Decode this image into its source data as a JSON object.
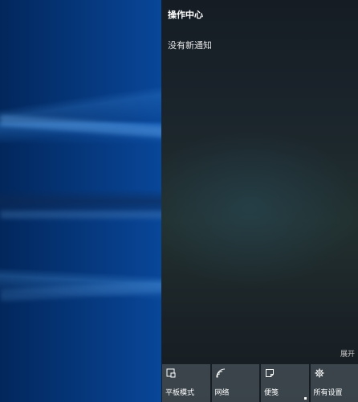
{
  "action_center": {
    "title": "操作中心",
    "status": "没有新通知",
    "expand_label": "展开",
    "quick_actions": [
      {
        "label": "平板模式",
        "icon": "tablet-mode-icon"
      },
      {
        "label": "网络",
        "icon": "network-icon"
      },
      {
        "label": "便笺",
        "icon": "note-icon"
      },
      {
        "label": "所有设置",
        "icon": "gear-icon"
      }
    ]
  },
  "colors": {
    "panel_background": "#1b252c",
    "tile_background": "#5a646e",
    "desktop_accent": "#0a5ab8"
  }
}
